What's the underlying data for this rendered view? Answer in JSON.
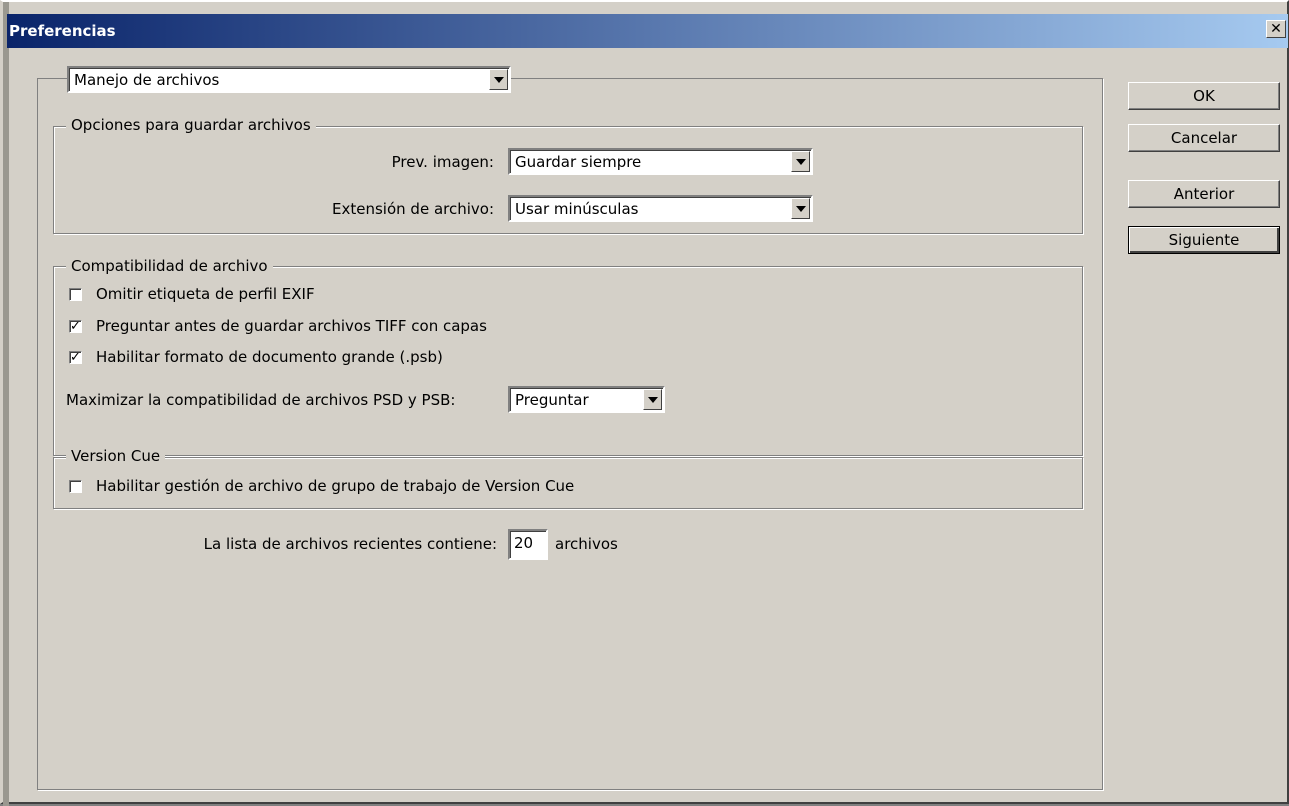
{
  "window": {
    "title": "Preferencias",
    "close_symbol": "✕"
  },
  "category": {
    "selected": "Manejo de archivos"
  },
  "save_options": {
    "legend": "Opciones para guardar archivos",
    "preview_label": "Prev. imagen:",
    "preview_value": "Guardar siempre",
    "extension_label": "Extensión de archivo:",
    "extension_value": "Usar minúsculas"
  },
  "compat": {
    "legend": "Compatibilidad de archivo",
    "items": [
      {
        "label": "Omitir etiqueta de perfil EXIF",
        "checked": ""
      },
      {
        "label": "Preguntar antes de guardar archivos TIFF con capas",
        "checked": "✓"
      },
      {
        "label": "Habilitar formato de documento grande (.psb)",
        "checked": "✓"
      }
    ],
    "maximize_label": "Maximizar la compatibilidad de archivos PSD y PSB:",
    "maximize_value": "Preguntar"
  },
  "version_cue": {
    "legend": "Version Cue",
    "item_label": "Habilitar gestión de archivo de grupo de trabajo de Version Cue",
    "item_checked": ""
  },
  "recent": {
    "label": "La lista de archivos recientes contiene:",
    "value": "20",
    "suffix": "archivos"
  },
  "buttons": {
    "ok": "OK",
    "cancel": "Cancelar",
    "prev": "Anterior",
    "next": "Siguiente"
  }
}
